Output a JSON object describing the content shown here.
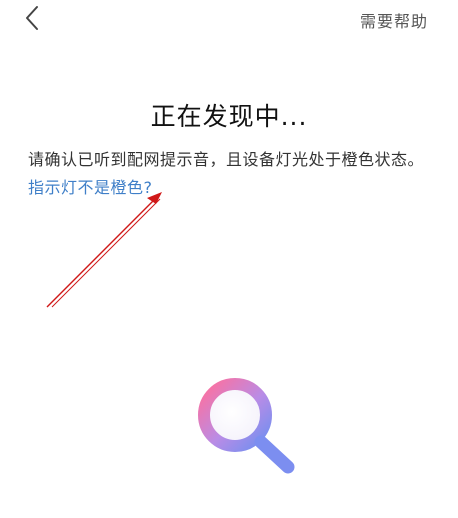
{
  "header": {
    "back_icon": "chevron-left-icon",
    "help_label": "需要帮助"
  },
  "main": {
    "title": "正在发现中...",
    "instruction_text": "请确认已听到配网提示音，且设备灯光处于橙色状态。",
    "instruction_link": "指示灯不是橙色?"
  },
  "graphic": {
    "icon": "magnifier-search-icon",
    "gradient_colors": [
      "#ff6f9c",
      "#b98ce6",
      "#6f8ff0"
    ]
  },
  "colors": {
    "link": "#3f7fc8",
    "annotation": "#d01818"
  }
}
